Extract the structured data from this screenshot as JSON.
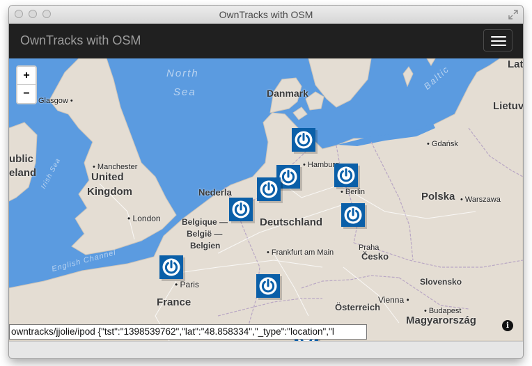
{
  "window": {
    "title": "OwnTracks with OSM"
  },
  "navbar": {
    "brand": "OwnTracks with OSM"
  },
  "zoom": {
    "in_label": "+",
    "out_label": "−"
  },
  "map": {
    "countries": [
      {
        "key": "danmark",
        "label": "Danmark"
      },
      {
        "key": "united",
        "label": "United"
      },
      {
        "key": "kingdom",
        "label": "Kingdom"
      },
      {
        "key": "nederland",
        "label": "Nederla"
      },
      {
        "key": "belgique",
        "label": "Belgique —"
      },
      {
        "key": "belgie",
        "label": "België —"
      },
      {
        "key": "belgien",
        "label": "Belgien"
      },
      {
        "key": "deutschland",
        "label": "Deutschland"
      },
      {
        "key": "polska",
        "label": "Polska"
      },
      {
        "key": "cesko",
        "label": "Česko"
      },
      {
        "key": "slovensko",
        "label": "Slovensko"
      },
      {
        "key": "osterreich",
        "label": "Österreich"
      },
      {
        "key": "magyarorszag",
        "label": "Magyarország"
      },
      {
        "key": "france",
        "label": "France"
      },
      {
        "key": "lietuva",
        "label": "Lietuv"
      },
      {
        "key": "latvia",
        "label": "Lat"
      },
      {
        "key": "ublic",
        "label": "ublic"
      },
      {
        "key": "eland",
        "label": "eland"
      }
    ],
    "cities": [
      {
        "key": "glasgow",
        "label": "Glasgow"
      },
      {
        "key": "manchester",
        "label": "Manchester"
      },
      {
        "key": "london",
        "label": "London"
      },
      {
        "key": "hamburg",
        "label": "Hamburg"
      },
      {
        "key": "berlin",
        "label": "Berlin"
      },
      {
        "key": "gdansk",
        "label": "Gdańsk"
      },
      {
        "key": "warszawa",
        "label": "Warszawa"
      },
      {
        "key": "frankfurt",
        "label": "Frankfurt am Main"
      },
      {
        "key": "praha",
        "label": "Praha"
      },
      {
        "key": "vienna",
        "label": "Vienna"
      },
      {
        "key": "budapest",
        "label": "Budapest"
      },
      {
        "key": "paris",
        "label": "Paris"
      }
    ],
    "seas": [
      {
        "key": "north",
        "label": "North"
      },
      {
        "key": "sea",
        "label": "Sea"
      },
      {
        "key": "baltic",
        "label": "Baltic"
      },
      {
        "key": "irish",
        "label": "Irish Sea"
      },
      {
        "key": "channel",
        "label": "English Channel"
      }
    ],
    "marker_icon": "owntracks-power-icon",
    "info_label": "i"
  },
  "status": {
    "message": "owntracks/jjolie/ipod {\"tst\":\"1398539762\",\"lat\":\"48.858334\",\"_type\":\"location\",\"l"
  },
  "colors": {
    "water": "#5b9be0",
    "land": "#e4ddd3",
    "navbar": "#202020",
    "marker": "#0a5fa8"
  }
}
